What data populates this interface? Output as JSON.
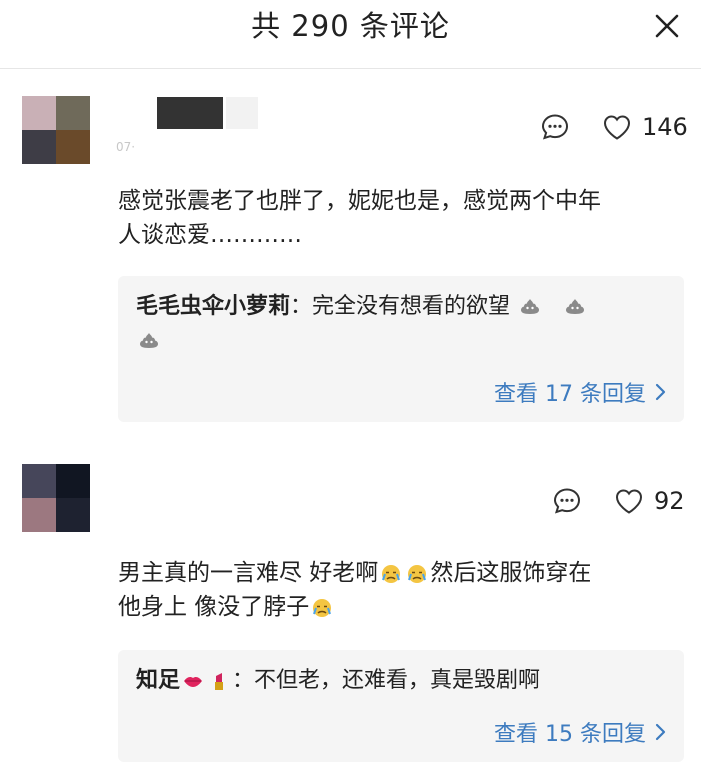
{
  "header": {
    "title": "共 290 条评论",
    "close_icon": "close-icon"
  },
  "comments": [
    {
      "meta": "07·",
      "like_count": "146",
      "text_line1": "感觉张震老了也胖了，妮妮也是，感觉两个中年",
      "text_line2": "人谈恋爱…………",
      "reply": {
        "author": "毛毛虫伞小萝莉",
        "separator": "：",
        "content": "完全没有想看的欲望",
        "emojis": [
          "poop-emoji",
          "poop-emoji",
          "poop-emoji"
        ],
        "more_label": "查看 17 条回复"
      }
    },
    {
      "like_count": "92",
      "text_part1": "男主真的一言难尽   好老啊",
      "text_part2": "然后这服饰穿在",
      "text_line2": "他身上  像没了脖子",
      "emojis_line1": [
        "crying-emoji",
        "crying-emoji"
      ],
      "emoji_line2": "crying-emoji",
      "reply": {
        "author": "知足",
        "emojis": [
          "lips-emoji",
          "lipstick-emoji"
        ],
        "separator": "：",
        "content": "不但老，还难看，真是毁剧啊",
        "more_label": "查看 15 条回复"
      }
    }
  ],
  "colors": {
    "link": "#3d7bbf",
    "reply_bg": "#f5f5f5",
    "text": "#222222"
  }
}
